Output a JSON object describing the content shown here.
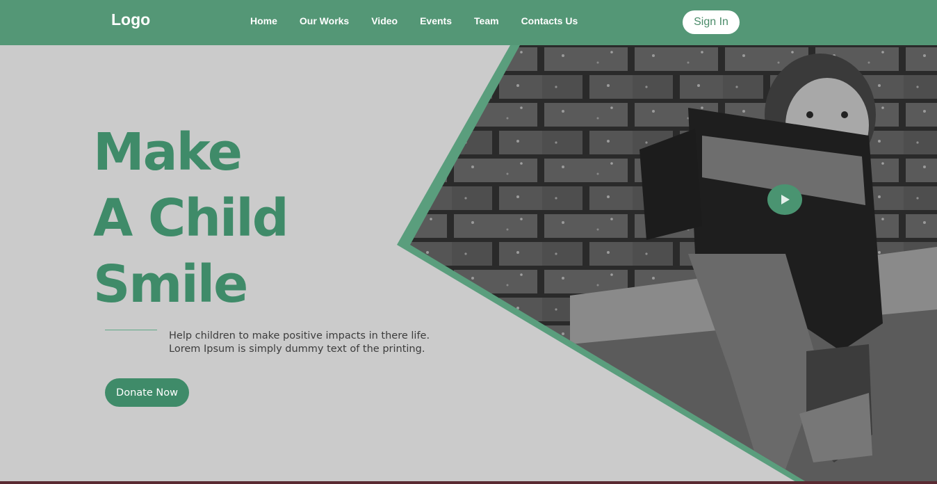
{
  "header": {
    "logo": "Logo",
    "nav": [
      {
        "label": "Home"
      },
      {
        "label": "Our Works"
      },
      {
        "label": "Video"
      },
      {
        "label": "Events"
      },
      {
        "label": "Team"
      },
      {
        "label": "Contacts Us"
      }
    ],
    "signin_label": "Sign In"
  },
  "hero": {
    "headline": [
      "Make",
      "A Child",
      "Smile"
    ],
    "description": [
      "Help children to make positive impacts in there life.",
      "Lorem Ipsum is simply dummy text of the printing."
    ],
    "donate_label": "Donate Now",
    "image_icon": "child-photo",
    "play_icon": "play-icon"
  },
  "colors": {
    "brand": "#549776",
    "accent_text": "#3f8b69",
    "background": "#cbcbcb",
    "white": "#ffffff"
  }
}
